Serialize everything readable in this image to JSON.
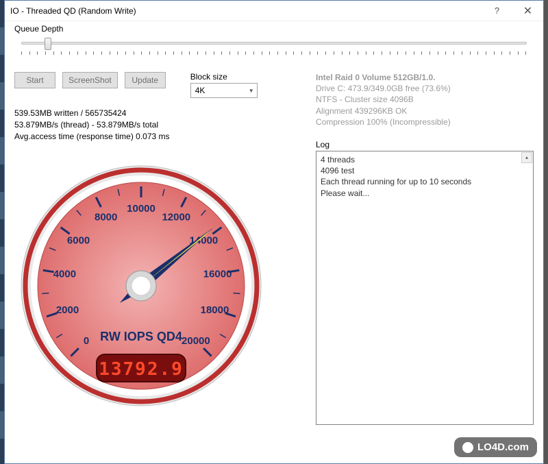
{
  "window": {
    "title": "IO - Threaded QD (Random Write)",
    "help": "?",
    "close": "✕"
  },
  "queue_depth": {
    "label": "Queue Depth",
    "value": 4,
    "min": 1,
    "max": 64
  },
  "buttons": {
    "start": "Start",
    "screenshot": "ScreenShot",
    "update": "Update"
  },
  "block_size": {
    "label": "Block size",
    "selected": "4K"
  },
  "drive": {
    "name": "Intel Raid 0 Volume 512GB/1.0.",
    "free": "Drive C: 473.9/349.0GB free (73.6%)",
    "fs": "NTFS - Cluster size 4096B",
    "align": "Alignment 439296KB OK",
    "comp": "Compression 100% (Incompressible)"
  },
  "stats": {
    "line1": "539.53MB written / 565735424",
    "line2": "53.879MB/s (thread) - 53.879MB/s total",
    "line3": "Avg.access time (response time) 0.073 ms"
  },
  "gauge": {
    "label": "RW IOPS QD4",
    "min": 0,
    "max": 20000,
    "value": 13792.9,
    "ticks": [
      0,
      2000,
      4000,
      6000,
      8000,
      10000,
      12000,
      14000,
      16000,
      18000,
      20000
    ],
    "display": "13792.9"
  },
  "log": {
    "label": "Log",
    "lines": [
      "4 threads",
      "4096 test",
      "Each thread running for up to 10 seconds",
      "Please wait..."
    ]
  },
  "watermark": "LO4D.com",
  "chart_data": {
    "type": "gauge",
    "title": "RW IOPS QD4",
    "min": 0,
    "max": 20000,
    "value": 13792.9,
    "ticks": [
      0,
      2000,
      4000,
      6000,
      8000,
      10000,
      12000,
      14000,
      16000,
      18000,
      20000
    ],
    "unit": "IOPS"
  }
}
